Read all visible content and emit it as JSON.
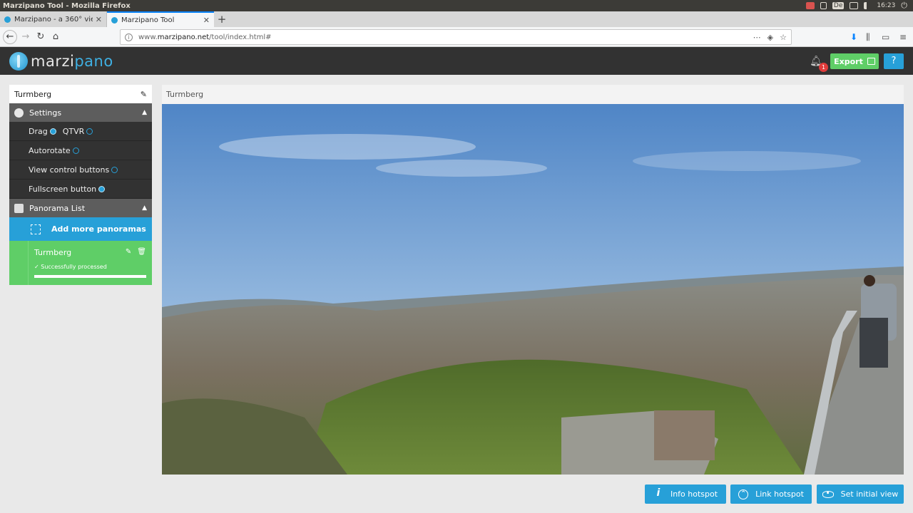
{
  "os": {
    "window_title": "Marzipano Tool - Mozilla Firefox",
    "keyboard_layout": "De",
    "clock": "16:23"
  },
  "browser": {
    "tabs": [
      {
        "label": "Marzipano - a 360° viewer for the m"
      },
      {
        "label": "Marzipano Tool"
      }
    ],
    "new_tab_label": "+",
    "url_prefix": "www.",
    "url_domain": "marzipano.net",
    "url_path": "/tool/index.html#"
  },
  "app": {
    "logo_left": "marzi",
    "logo_right": "pano",
    "notification_count": "1",
    "export_label": "Export",
    "help_label": "?"
  },
  "sidebar": {
    "project_name": "Turmberg",
    "settings_label": "Settings",
    "settings": {
      "drag_label": "Drag",
      "qtvr_label": "QTVR",
      "autorotate_label": "Autorotate",
      "view_control_label": "View control buttons",
      "fullscreen_label": "Fullscreen button"
    },
    "panorama_list_label": "Panorama List",
    "add_label": "Add more panoramas",
    "panoramas": [
      {
        "name": "Turmberg",
        "status": "Successfully processed",
        "progress": 1.0
      }
    ]
  },
  "viewer": {
    "title": "Turmberg"
  },
  "actions": {
    "info_hotspot": "Info hotspot",
    "link_hotspot": "Link hotspot",
    "set_initial_view": "Set initial view"
  },
  "colors": {
    "accent_blue": "#27a0d8",
    "success_green": "#5fce67",
    "header_dark": "#323232",
    "section_gray": "#5d5d5d"
  }
}
